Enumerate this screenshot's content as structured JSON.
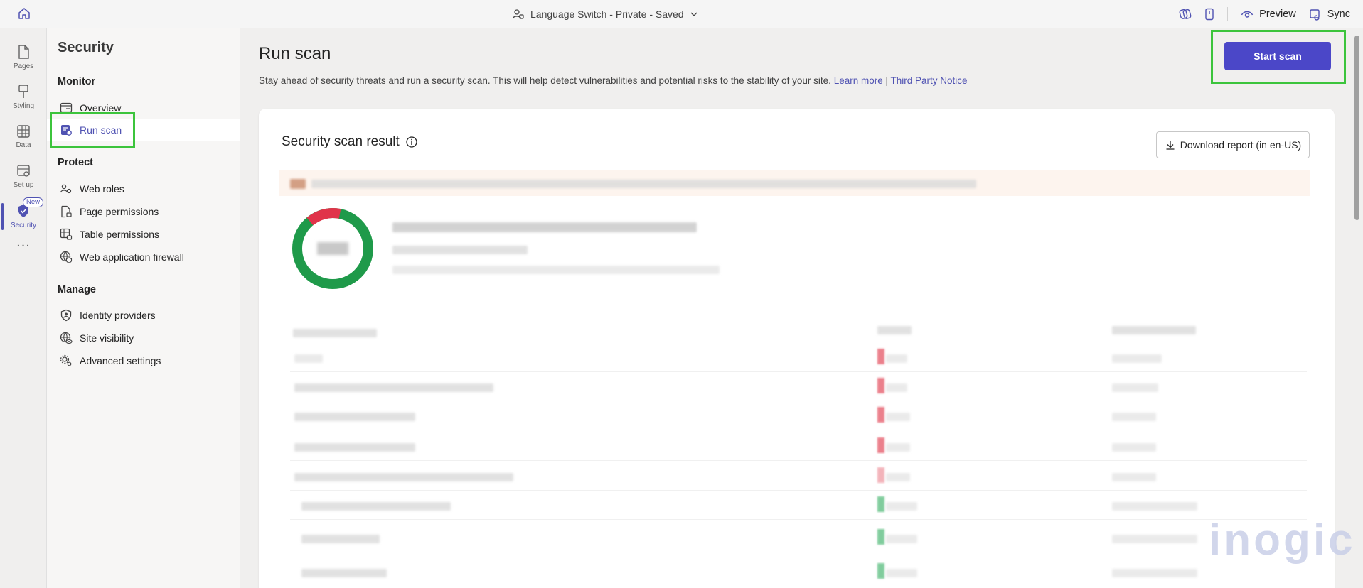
{
  "topbar": {
    "site_title": "Language Switch - Private - Saved",
    "preview_label": "Preview",
    "sync_label": "Sync"
  },
  "rail": {
    "items": [
      {
        "label": "Pages",
        "icon": "page-icon"
      },
      {
        "label": "Styling",
        "icon": "brush-icon"
      },
      {
        "label": "Data",
        "icon": "table-icon"
      },
      {
        "label": "Set up",
        "icon": "setup-icon"
      },
      {
        "label": "Security",
        "icon": "shield-icon",
        "badge": "New",
        "active": true
      }
    ],
    "more": "..."
  },
  "panel": {
    "title": "Security",
    "groups": {
      "monitor": "Monitor",
      "protect": "Protect",
      "manage": "Manage"
    },
    "monitor_items": [
      "Overview",
      "Run scan"
    ],
    "protect_items": [
      "Web roles",
      "Page permissions",
      "Table permissions",
      "Web application firewall"
    ],
    "manage_items": [
      "Identity providers",
      "Site visibility",
      "Advanced settings"
    ]
  },
  "main": {
    "title": "Run scan",
    "description": "Stay ahead of security threats and run a security scan. This will help detect vulnerabilities and potential risks to the stability of your site.",
    "learn_more": "Learn more",
    "separator": "|",
    "third_party": "Third Party Notice",
    "start_scan": "Start scan",
    "card": {
      "title": "Security scan result",
      "download": "Download report (in en-US)"
    }
  },
  "watermark": "inogic",
  "colors": {
    "accent": "#4f52b2",
    "primary_button": "#4b47c8",
    "highlight": "#3cc43c"
  }
}
